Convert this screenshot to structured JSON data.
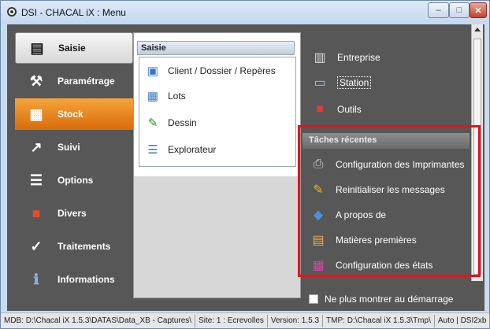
{
  "window": {
    "title": "DSI - CHACAL iX : Menu",
    "min": "–",
    "max": "□",
    "close": "✕"
  },
  "nav": {
    "items": [
      {
        "label": "Saisie",
        "icon": "▤"
      },
      {
        "label": "Paramétrage",
        "icon": "⚒"
      },
      {
        "label": "Stock",
        "icon": "▦"
      },
      {
        "label": "Suivi",
        "icon": "↗"
      },
      {
        "label": "Options",
        "icon": "☰"
      },
      {
        "label": "Divers",
        "icon": "■"
      },
      {
        "label": "Traitements",
        "icon": "✓"
      },
      {
        "label": "Informations",
        "icon": "ℹ"
      }
    ]
  },
  "middle": {
    "header": "Saisie",
    "items": [
      {
        "label": "Client / Dossier / Repères",
        "icon": "▣"
      },
      {
        "label": "Lots",
        "icon": "▦"
      },
      {
        "label": "Dessin",
        "icon": "✎"
      },
      {
        "label": "Explorateur",
        "icon": "☰"
      }
    ]
  },
  "right": {
    "top_items": [
      {
        "label": "Entreprise",
        "icon": "▥"
      },
      {
        "label": "Station",
        "icon": "▭"
      },
      {
        "label": "Outils",
        "icon": "■"
      }
    ],
    "recent_header": "Tâches récentes",
    "recent_items": [
      {
        "label": "Configuration des Imprimantes",
        "icon": "⎙"
      },
      {
        "label": "Reinitialiser les messages",
        "icon": "✎"
      },
      {
        "label": "A propos de",
        "icon": "◆"
      },
      {
        "label": "Matières premières",
        "icon": "▤"
      },
      {
        "label": "Configuration des états",
        "icon": "▦"
      }
    ],
    "checkbox_label": "Ne plus montrer au démarrage"
  },
  "statusbar": {
    "mdb": "MDB: D:\\Chacal iX 1.5.3\\DATAS\\Data_XB - Captures\\",
    "site": "Site: 1 : Ecrevolles",
    "version": "Version: 1.5.3",
    "tmp": "TMP: D:\\Chacal iX 1.5.3\\Tmp\\",
    "auto": "Auto | DSI2xb"
  },
  "colors": {
    "highlight_box": "#e3131b",
    "stock_active": "#e8851f",
    "panel_bg": "#575757"
  }
}
